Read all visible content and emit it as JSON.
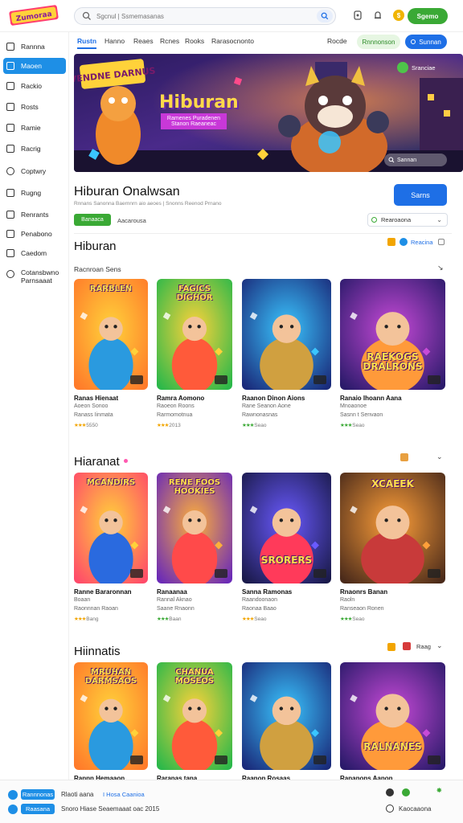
{
  "colors": {
    "accent_blue": "#1e6fe6",
    "sidebar_active": "#1e8fe6",
    "green": "#3aa935"
  },
  "brand": {
    "logo_text": "Zumoraa"
  },
  "search": {
    "placeholder": "Sgcnul | Ssmemasanas"
  },
  "top_cta": "Sgemo",
  "sidebar": {
    "items": [
      {
        "label": "Rannna",
        "icon": "home-icon"
      },
      {
        "label": "Maoen",
        "icon": "grid-icon"
      },
      {
        "label": "Rackio",
        "icon": "doc-icon"
      },
      {
        "label": "Rosts",
        "icon": "doc-icon"
      },
      {
        "label": "Ramie",
        "icon": "doc-icon"
      },
      {
        "label": "Racrig",
        "icon": "check-icon"
      },
      {
        "label": "Coptwry",
        "icon": "gear-icon"
      },
      {
        "label": "Rugng",
        "icon": "book-icon"
      },
      {
        "label": "Renrants",
        "icon": "doc-icon"
      },
      {
        "label": "Penabono",
        "icon": "doc-icon"
      },
      {
        "label": "Caedom",
        "icon": "doc-icon"
      },
      {
        "label": "Cotansbwno Parnsaaat",
        "icon": "gear-icon"
      }
    ]
  },
  "nav": {
    "tabs": [
      "Rustn",
      "Hanno",
      "Reaes",
      "Rcnes",
      "Rooks",
      "Rarasocnonto"
    ],
    "right_text": "Rocde",
    "right_btn1": "Rnnnonson",
    "right_btn2": "Sunnan"
  },
  "hero": {
    "art_title": "VENDNE DARNUS",
    "title": "Hiburan",
    "subtitle": "Ramenes Puradenen Stanon Raeaneac",
    "badge": "Sranciae",
    "search_text": "Sannan"
  },
  "page": {
    "title": "Hiburan Onalwsan",
    "subtitle": "Rnnans Sanonna Baernnrn aio aeoes | Snonns Reenod Prnano",
    "button": "Sarns",
    "chip": "Banaaca",
    "chip_text": "Aacarousa",
    "sort": "Rearoaona"
  },
  "sections": [
    {
      "title": "Hiburan",
      "subtitle": "Racnroan Sens",
      "right_text": "Reacina",
      "cards": [
        {
          "art": "RARBLEN",
          "title": "Ranas Hienaat",
          "line1": "Aoeon Sonoo",
          "line2": "Ranass Iinmata",
          "rating": "5550",
          "rate_color": "orange"
        },
        {
          "art": "FAGICS DIGHOR",
          "title": "Ramra Aomono",
          "line1": "Raoeon Roons",
          "line2": "Rarmomotnua",
          "rating": "2013",
          "rate_color": "orange"
        },
        {
          "art": "",
          "title": "Raanon Dinon Aions",
          "line1": "Rane Seanon Aone",
          "line2": "Rawnonasnas",
          "rating": "Seao",
          "rate_color": "green"
        },
        {
          "art": "RAEKOGS DRALRONS",
          "title": "Ranaio Ihoann Aana",
          "line1": "Mnoaonoe",
          "line2": "Sasnn t Senvaon",
          "rating": "Seao",
          "rate_color": "green"
        }
      ]
    },
    {
      "title": "Hiaranat",
      "subtitle": "",
      "right_text": "",
      "cards": [
        {
          "art": "MCANDIRS",
          "title": "Ranne Bararonnan",
          "line1": "Boaan",
          "line2": "Raonnnan Raoan",
          "rating": "Bang",
          "rate_color": "orange"
        },
        {
          "art": "RENE FOOS HOOKIES",
          "title": "Ranaanaa",
          "line1": "Rannal Aknao",
          "line2": "Saane Rnaonn",
          "rating": "Baan",
          "rate_color": "green"
        },
        {
          "art": "SRORERS",
          "title": "Sanna Ramonas",
          "line1": "Raandoonaon",
          "line2": "Raonaa Baao",
          "rating": "Seao",
          "rate_color": "orange"
        },
        {
          "art": "XCAEEK",
          "title": "Rnaonrs Banan",
          "line1": "Raoln",
          "line2": "Ranseaon Ronen",
          "rating": "Seao",
          "rate_color": "green"
        }
      ]
    },
    {
      "title": "Hiinnatis",
      "subtitle": "",
      "right_text": "Raag",
      "cards": [
        {
          "art": "MRUHAN DARMSAOS",
          "title": "Rannn Hemaaon",
          "line1": "",
          "line2": "",
          "rating": "",
          "rate_color": "orange"
        },
        {
          "art": "CHANUA MOSEOS",
          "title": "Raranas tana",
          "line1": "",
          "line2": "",
          "rating": "",
          "rate_color": "orange"
        },
        {
          "art": "",
          "title": "Raanon Rosaas",
          "line1": "",
          "line2": "",
          "rating": "",
          "rate_color": "orange"
        },
        {
          "art": "RALNANES",
          "title": "Rananons Aanon",
          "line1": "",
          "line2": "",
          "rating": "",
          "rate_color": "orange"
        }
      ]
    }
  ],
  "footer": {
    "btn1": "Rannnonas",
    "text1": "Rlaoti aana",
    "link1": "I Hosa Caanioa",
    "btn2": "Raasana",
    "text2": "Snoro Hiase Seaemaaat oac 2015",
    "right_text": "Kaocaaona"
  }
}
